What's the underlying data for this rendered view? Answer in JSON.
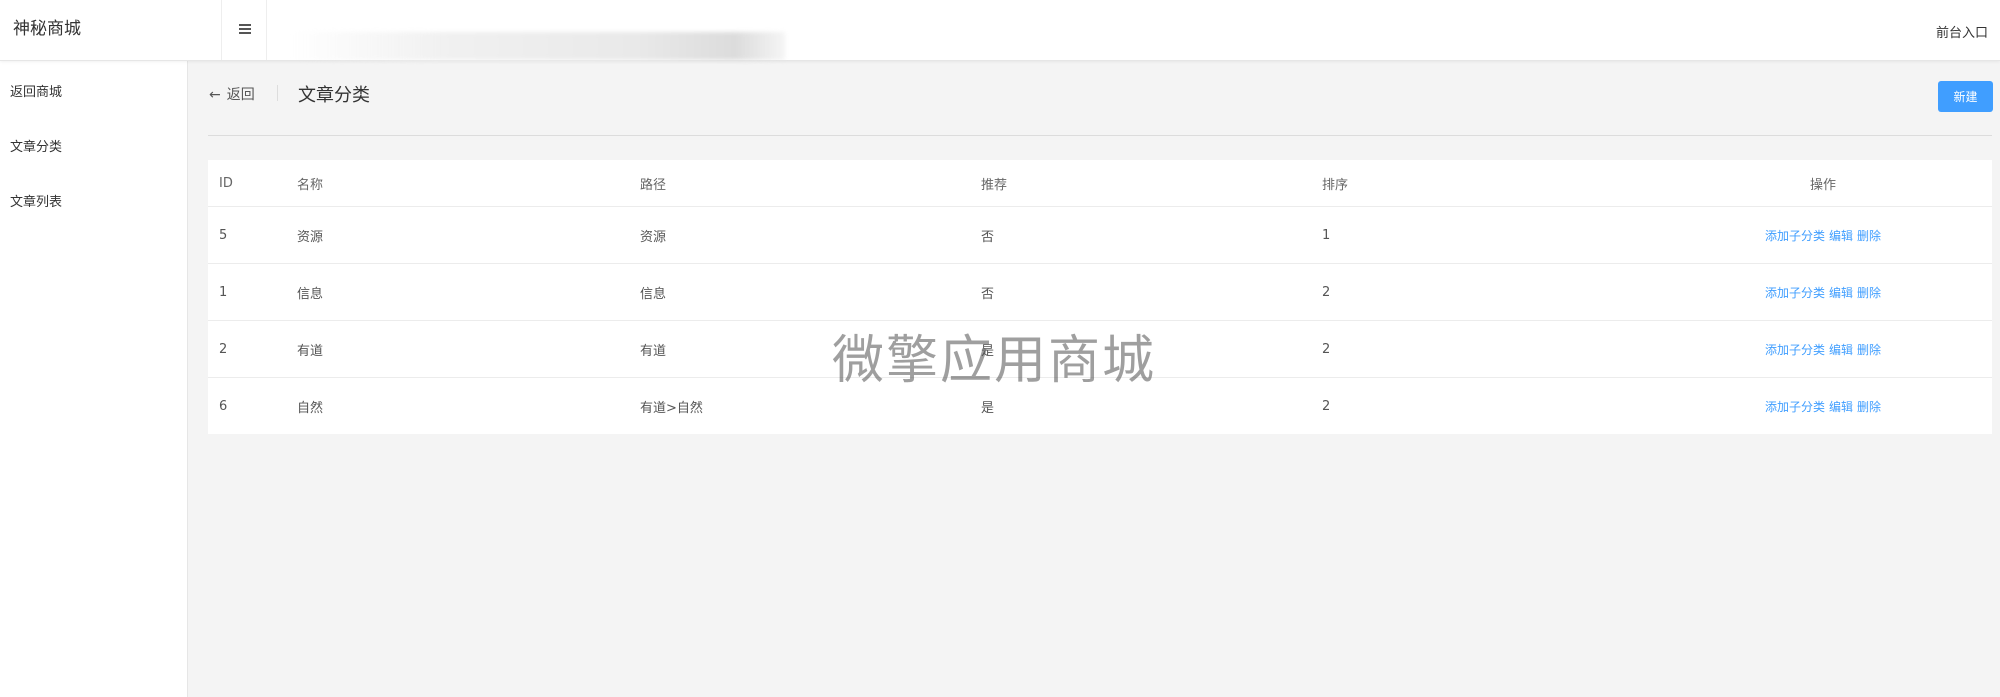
{
  "header": {
    "brand": "神秘商城",
    "menu_icon": "hamburger-icon",
    "front_entry": "前台入口"
  },
  "sidebar": {
    "items": [
      {
        "label": "返回商城"
      },
      {
        "label": "文章分类"
      },
      {
        "label": "文章列表"
      }
    ]
  },
  "main": {
    "back_label": "返回",
    "back_icon": "arrow-left-icon",
    "title": "文章分类",
    "new_button": "新建"
  },
  "table": {
    "columns": [
      "ID",
      "名称",
      "路径",
      "推荐",
      "排序",
      "操作"
    ],
    "rows": [
      {
        "id": "5",
        "name": "资源",
        "path": "资源",
        "recommend": "否",
        "sort": "1"
      },
      {
        "id": "1",
        "name": "信息",
        "path": "信息",
        "recommend": "否",
        "sort": "2"
      },
      {
        "id": "2",
        "name": "有道",
        "path": "有道",
        "recommend": "是",
        "sort": "2"
      },
      {
        "id": "6",
        "name": "自然",
        "path": "有道>自然",
        "recommend": "是",
        "sort": "2"
      }
    ],
    "actions": {
      "add_child": "添加子分类",
      "edit": "编辑",
      "delete": "删除"
    }
  },
  "watermark": "微擎应用商城",
  "colors": {
    "accent": "#409eff",
    "main_bg": "#f4f4f4"
  }
}
